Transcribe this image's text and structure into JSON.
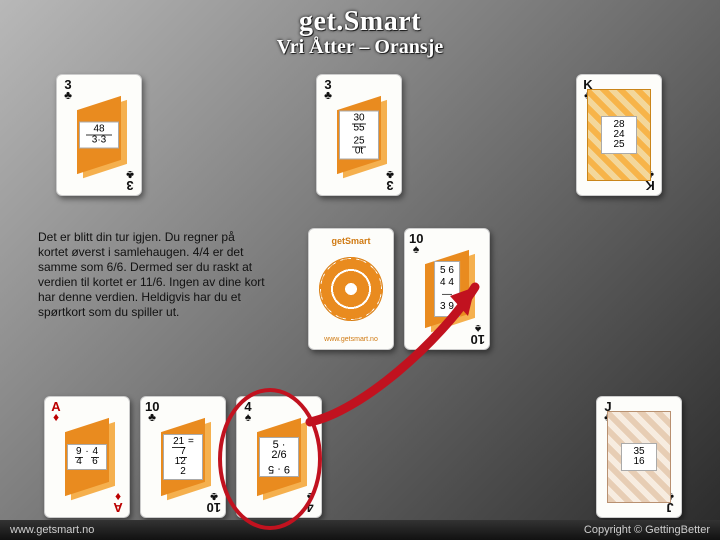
{
  "title": "get.Smart",
  "subtitle": "Vri Åtter – Oransje",
  "footer": {
    "left": "www.getsmart.no",
    "right": "Copyright © GettingBetter"
  },
  "deck_brand": "getSmart",
  "deck_site": "www.getsmart.no",
  "paragraph": "Det er blitt din tur igjen. Du regner på kortet øverst i samlehaugen. 4/4 er det samme som 6/6. Dermed ser du raskt at verdien til kortet er 11/6. Ingen av dine kort har denne verdien. Heldigvis har du et spørtkort som du spiller ut.",
  "cards": {
    "top1": {
      "rank": "3",
      "suit": "♣",
      "color": "black",
      "frac": {
        "n": "48",
        "d": "3·3"
      },
      "mirror": {
        "n": "48",
        "d": "3·3"
      }
    },
    "top2": {
      "rank": "3",
      "suit": "♣",
      "color": "black",
      "frac": {
        "n1": "30",
        "d1": "55",
        "n2": "25",
        "d2": "0t"
      }
    },
    "top3": {
      "rank": "K",
      "suit": "♣",
      "color": "black",
      "pic": {
        "a": "28",
        "b": "24",
        "c": "25"
      }
    },
    "pileTop": {
      "rank": "10",
      "suit": "♠",
      "color": "black",
      "list": [
        "5 6",
        "4 4",
        "—",
        "3 9"
      ]
    },
    "hand1": {
      "rank": "A",
      "suit": "♦",
      "color": "red",
      "frac": {
        "n1": "9",
        "d1": "4",
        "n2": "4",
        "d2": "6"
      }
    },
    "hand2": {
      "rank": "10",
      "suit": "♣",
      "color": "black",
      "frac": {
        "n1": "21",
        "d1": "12",
        "n2": "7",
        "d2": "2"
      }
    },
    "hand3": {
      "rank": "4",
      "suit": "♠",
      "color": "black",
      "expr_top": "5 · 2/6",
      "expr_bot": "9 · 5"
    },
    "hand4": {
      "rank": "J",
      "suit": "♣",
      "color": "black",
      "pic": {
        "a": "35",
        "b": "16"
      }
    }
  }
}
